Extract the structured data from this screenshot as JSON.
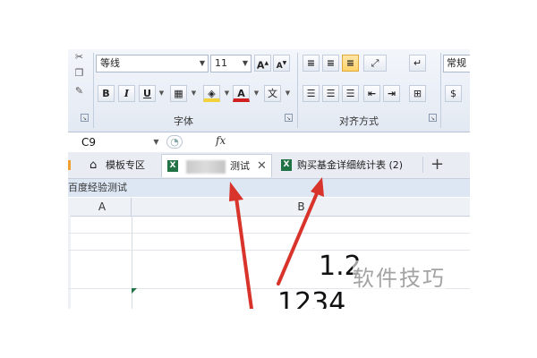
{
  "ribbon": {
    "font_name": "等线",
    "font_size": "11",
    "font_group_label": "字体",
    "align_group_label": "对齐方式",
    "number_format": "常规",
    "buttons": {
      "bold": "B",
      "italic": "I",
      "underline": "U",
      "grow_font": "A",
      "shrink_font": "A",
      "font_color": "A",
      "phonetic": "文"
    }
  },
  "formula_bar": {
    "name_box": "C9",
    "fx": "fx"
  },
  "tabs": [
    {
      "label": "模板专区",
      "icon": "home-icon"
    },
    {
      "label": "测试",
      "icon": "excel-icon",
      "active": true
    },
    {
      "label": "购买基金详细统计表 (2)",
      "icon": "excel-icon"
    }
  ],
  "doc_title": "百度经验测试",
  "grid": {
    "columns": [
      "A",
      "B"
    ],
    "cell_values": [
      "1.2",
      "1234"
    ]
  },
  "watermark": "软件技巧",
  "colors": {
    "excel_green": "#217346",
    "arrow_red": "#d8342b",
    "font_color_red": "#d02020",
    "highlight_yellow": "#f2d13a"
  }
}
